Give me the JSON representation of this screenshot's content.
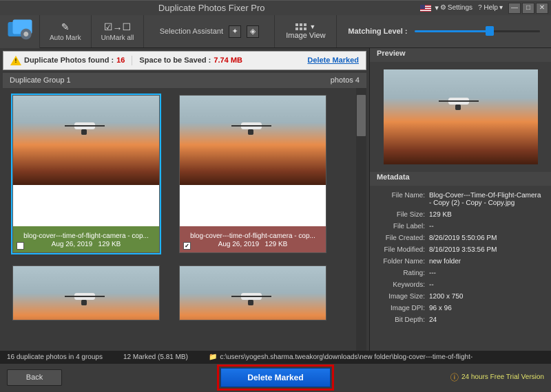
{
  "titlebar": {
    "app_title": "Duplicate Photos Fixer Pro",
    "settings": "Settings",
    "help": "? Help",
    "lang_dropdown": "▾"
  },
  "toolbar": {
    "auto_mark": "Auto Mark",
    "unmark_all": "UnMark all",
    "selection_assistant": "Selection Assistant",
    "image_view": "Image View",
    "matching_level": "Matching Level :",
    "match_pct": 60
  },
  "status": {
    "found_label": "Duplicate Photos found :",
    "found_count": "16",
    "space_label": "Space to be Saved :",
    "space_value": "7.74 MB",
    "delete_marked": "Delete Marked"
  },
  "group": {
    "name": "Duplicate Group 1",
    "count": "photos 4"
  },
  "cards": [
    {
      "name": "blog-cover---time-of-flight-camera - cop...",
      "date": "Aug 26, 2019",
      "size": "129 KB",
      "marked": false,
      "color": "green"
    },
    {
      "name": "blog-cover---time-of-flight-camera - cop...",
      "date": "Aug 26, 2019",
      "size": "129 KB",
      "marked": true,
      "color": "red"
    }
  ],
  "right": {
    "preview": "Preview",
    "metadata": "Metadata"
  },
  "meta": [
    {
      "k": "File Name:",
      "v": "Blog-Cover---Time-Of-Flight-Camera - Copy (2) - Copy - Copy.jpg"
    },
    {
      "k": "File Size:",
      "v": "129 KB"
    },
    {
      "k": "File Label:",
      "v": "--"
    },
    {
      "k": "File Created:",
      "v": "8/26/2019 5:50:06 PM"
    },
    {
      "k": "File Modified:",
      "v": "8/16/2019 3:53:56 PM"
    },
    {
      "k": "Folder Name:",
      "v": "new folder"
    },
    {
      "k": "Rating:",
      "v": "---"
    },
    {
      "k": "Keywords:",
      "v": "--"
    },
    {
      "k": "Image Size:",
      "v": "1200 x 750"
    },
    {
      "k": "Image DPI:",
      "v": "96 x 96"
    },
    {
      "k": "Bit Depth:",
      "v": "24"
    }
  ],
  "bottom": {
    "summary": "16 duplicate photos in 4 groups",
    "marked": "12 Marked (5.81 MB)",
    "path": "c:\\users\\yogesh.sharma.tweakorg\\downloads\\new folder\\blog-cover---time-of-flight-"
  },
  "footer": {
    "back": "Back",
    "delete_marked": "Delete Marked",
    "trial": "24 hours Free Trial Version"
  }
}
